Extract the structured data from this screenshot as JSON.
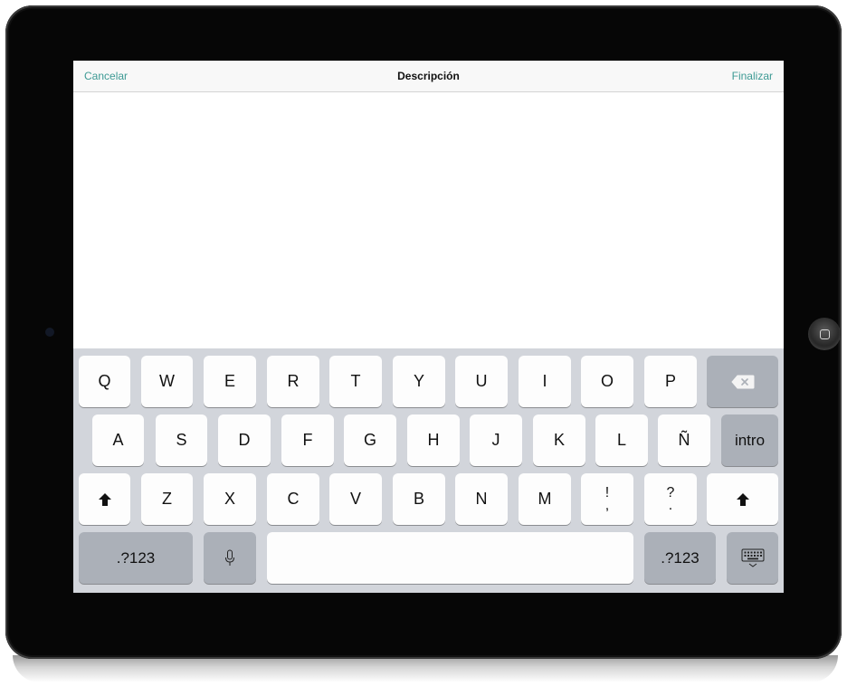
{
  "navbar": {
    "cancel_label": "Cancelar",
    "title": "Descripción",
    "done_label": "Finalizar"
  },
  "keyboard": {
    "row1": [
      "Q",
      "W",
      "E",
      "R",
      "T",
      "Y",
      "U",
      "I",
      "O",
      "P"
    ],
    "row2": [
      "A",
      "S",
      "D",
      "F",
      "G",
      "H",
      "J",
      "K",
      "L",
      "Ñ"
    ],
    "row3": [
      "Z",
      "X",
      "C",
      "V",
      "B",
      "N",
      "M"
    ],
    "punct1": {
      "top": "!",
      "bottom": ","
    },
    "punct2": {
      "top": "?",
      "bottom": "."
    },
    "return_label": "intro",
    "numbers_label": ".?123"
  },
  "colors": {
    "accent": "#3d9a94",
    "keyboard_bg": "#d2d5db",
    "key_bg": "#fdfdfd",
    "func_key_bg": "#abb0b8"
  }
}
